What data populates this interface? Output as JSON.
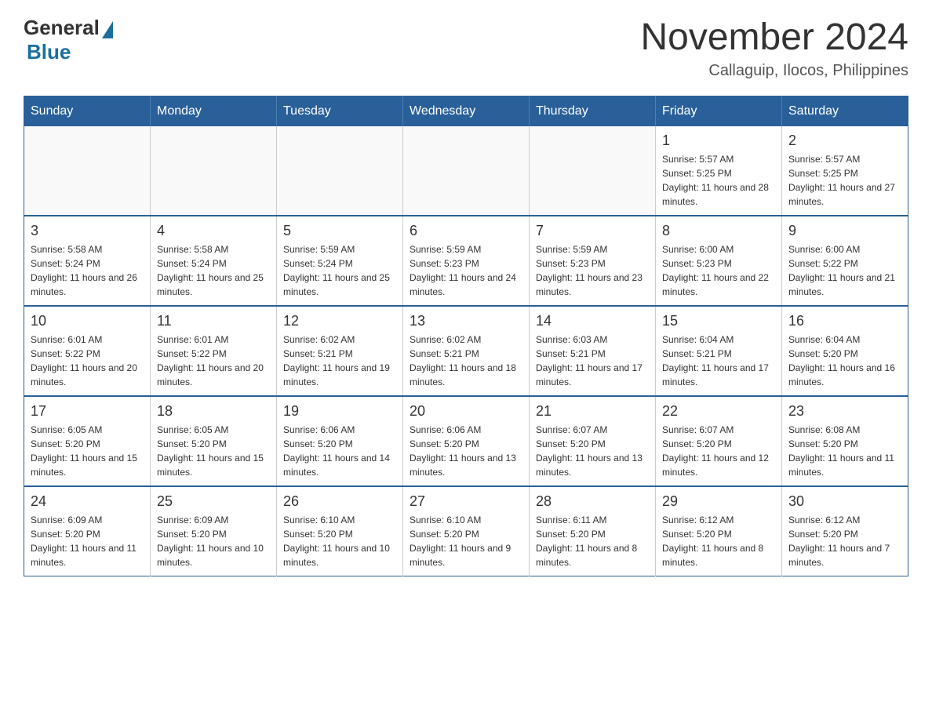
{
  "logo": {
    "general": "General",
    "blue": "Blue"
  },
  "title": {
    "main": "November 2024",
    "sub": "Callaguip, Ilocos, Philippines"
  },
  "weekdays": [
    "Sunday",
    "Monday",
    "Tuesday",
    "Wednesday",
    "Thursday",
    "Friday",
    "Saturday"
  ],
  "weeks": [
    [
      {
        "day": "",
        "info": ""
      },
      {
        "day": "",
        "info": ""
      },
      {
        "day": "",
        "info": ""
      },
      {
        "day": "",
        "info": ""
      },
      {
        "day": "",
        "info": ""
      },
      {
        "day": "1",
        "info": "Sunrise: 5:57 AM\nSunset: 5:25 PM\nDaylight: 11 hours and 28 minutes."
      },
      {
        "day": "2",
        "info": "Sunrise: 5:57 AM\nSunset: 5:25 PM\nDaylight: 11 hours and 27 minutes."
      }
    ],
    [
      {
        "day": "3",
        "info": "Sunrise: 5:58 AM\nSunset: 5:24 PM\nDaylight: 11 hours and 26 minutes."
      },
      {
        "day": "4",
        "info": "Sunrise: 5:58 AM\nSunset: 5:24 PM\nDaylight: 11 hours and 25 minutes."
      },
      {
        "day": "5",
        "info": "Sunrise: 5:59 AM\nSunset: 5:24 PM\nDaylight: 11 hours and 25 minutes."
      },
      {
        "day": "6",
        "info": "Sunrise: 5:59 AM\nSunset: 5:23 PM\nDaylight: 11 hours and 24 minutes."
      },
      {
        "day": "7",
        "info": "Sunrise: 5:59 AM\nSunset: 5:23 PM\nDaylight: 11 hours and 23 minutes."
      },
      {
        "day": "8",
        "info": "Sunrise: 6:00 AM\nSunset: 5:23 PM\nDaylight: 11 hours and 22 minutes."
      },
      {
        "day": "9",
        "info": "Sunrise: 6:00 AM\nSunset: 5:22 PM\nDaylight: 11 hours and 21 minutes."
      }
    ],
    [
      {
        "day": "10",
        "info": "Sunrise: 6:01 AM\nSunset: 5:22 PM\nDaylight: 11 hours and 20 minutes."
      },
      {
        "day": "11",
        "info": "Sunrise: 6:01 AM\nSunset: 5:22 PM\nDaylight: 11 hours and 20 minutes."
      },
      {
        "day": "12",
        "info": "Sunrise: 6:02 AM\nSunset: 5:21 PM\nDaylight: 11 hours and 19 minutes."
      },
      {
        "day": "13",
        "info": "Sunrise: 6:02 AM\nSunset: 5:21 PM\nDaylight: 11 hours and 18 minutes."
      },
      {
        "day": "14",
        "info": "Sunrise: 6:03 AM\nSunset: 5:21 PM\nDaylight: 11 hours and 17 minutes."
      },
      {
        "day": "15",
        "info": "Sunrise: 6:04 AM\nSunset: 5:21 PM\nDaylight: 11 hours and 17 minutes."
      },
      {
        "day": "16",
        "info": "Sunrise: 6:04 AM\nSunset: 5:20 PM\nDaylight: 11 hours and 16 minutes."
      }
    ],
    [
      {
        "day": "17",
        "info": "Sunrise: 6:05 AM\nSunset: 5:20 PM\nDaylight: 11 hours and 15 minutes."
      },
      {
        "day": "18",
        "info": "Sunrise: 6:05 AM\nSunset: 5:20 PM\nDaylight: 11 hours and 15 minutes."
      },
      {
        "day": "19",
        "info": "Sunrise: 6:06 AM\nSunset: 5:20 PM\nDaylight: 11 hours and 14 minutes."
      },
      {
        "day": "20",
        "info": "Sunrise: 6:06 AM\nSunset: 5:20 PM\nDaylight: 11 hours and 13 minutes."
      },
      {
        "day": "21",
        "info": "Sunrise: 6:07 AM\nSunset: 5:20 PM\nDaylight: 11 hours and 13 minutes."
      },
      {
        "day": "22",
        "info": "Sunrise: 6:07 AM\nSunset: 5:20 PM\nDaylight: 11 hours and 12 minutes."
      },
      {
        "day": "23",
        "info": "Sunrise: 6:08 AM\nSunset: 5:20 PM\nDaylight: 11 hours and 11 minutes."
      }
    ],
    [
      {
        "day": "24",
        "info": "Sunrise: 6:09 AM\nSunset: 5:20 PM\nDaylight: 11 hours and 11 minutes."
      },
      {
        "day": "25",
        "info": "Sunrise: 6:09 AM\nSunset: 5:20 PM\nDaylight: 11 hours and 10 minutes."
      },
      {
        "day": "26",
        "info": "Sunrise: 6:10 AM\nSunset: 5:20 PM\nDaylight: 11 hours and 10 minutes."
      },
      {
        "day": "27",
        "info": "Sunrise: 6:10 AM\nSunset: 5:20 PM\nDaylight: 11 hours and 9 minutes."
      },
      {
        "day": "28",
        "info": "Sunrise: 6:11 AM\nSunset: 5:20 PM\nDaylight: 11 hours and 8 minutes."
      },
      {
        "day": "29",
        "info": "Sunrise: 6:12 AM\nSunset: 5:20 PM\nDaylight: 11 hours and 8 minutes."
      },
      {
        "day": "30",
        "info": "Sunrise: 6:12 AM\nSunset: 5:20 PM\nDaylight: 11 hours and 7 minutes."
      }
    ]
  ]
}
